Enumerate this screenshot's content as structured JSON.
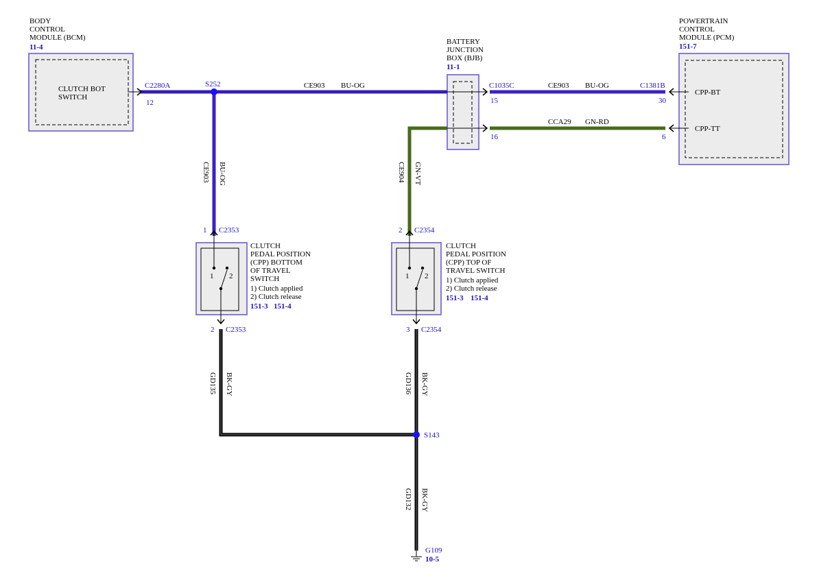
{
  "modules": {
    "bcm": {
      "name": "BODY\nCONTROL\nMODULE (BCM)",
      "ref": "11-4",
      "inner_label": "CLUTCH BOT\nSWITCH"
    },
    "bjb": {
      "name": "BATTERY\nJUNCTION\nBOX (BJB)",
      "ref": "11-1"
    },
    "pcm": {
      "name": "POWERTRAIN\nCONTROL\nMODULE (PCM)",
      "ref": "151-7",
      "pin_bt": "CPP-BT",
      "pin_tt": "CPP-TT"
    }
  },
  "connectors": {
    "c2280a": {
      "id": "C2280A",
      "pin": "12"
    },
    "c1035c": {
      "id": "C1035C",
      "pin_top": "15",
      "pin_bottom": "16"
    },
    "c1381b": {
      "id": "C1381B",
      "pin_top": "30",
      "pin_bottom": "6"
    },
    "c2353_top": {
      "id": "C2353",
      "pin": "1"
    },
    "c2353_bottom": {
      "id": "C2353",
      "pin": "2"
    },
    "c2354_top": {
      "id": "C2354",
      "pin": "2"
    },
    "c2354_bottom": {
      "id": "C2354",
      "pin": "3"
    }
  },
  "splices": {
    "s252": "S252",
    "s143": "S143"
  },
  "ground": {
    "id": "G109",
    "ref": "10-5"
  },
  "circuits": {
    "ce903_a": {
      "circuit": "CE903",
      "color": "BU-OG"
    },
    "ce903_b": {
      "circuit": "CE903",
      "color": "BU-OG"
    },
    "ce903_vert": {
      "circuit": "CE903",
      "color": "BU-OG"
    },
    "cca29": {
      "circuit": "CCA29",
      "color": "GN-RD"
    },
    "ce904": {
      "circuit": "CE904",
      "color": "GN-VT"
    },
    "gd135": {
      "circuit": "GD135",
      "color": "BK-GY"
    },
    "gd136": {
      "circuit": "GD136",
      "color": "BK-GY"
    },
    "gd132": {
      "circuit": "GD132",
      "color": "BK-GY"
    }
  },
  "switches": {
    "bottom": {
      "title": "CLUTCH\nPEDAL POSITION\n(CPP) BOTTOM\nOF TRAVEL\nSWITCH",
      "states": "1) Clutch applied\n2) Clutch release",
      "ref1": "151-3",
      "ref2": "151-4",
      "pos1": "1",
      "pos2": "2"
    },
    "top": {
      "title": "CLUTCH\nPEDAL POSITION\n(CPP) TOP OF\nTRAVEL SWITCH",
      "states": "1) Clutch applied\n2) Clutch release",
      "ref1": "151-3",
      "ref2": "151-4",
      "pos1": "1",
      "pos2": "2"
    }
  },
  "colors": {
    "blue_wire": "#3a22c8",
    "green_wire": "#4a6a1a",
    "black_wire": "#000000",
    "box_border": "#8a7ad8",
    "box_fill": "#ececec",
    "accent_blue": "#1a12c8"
  }
}
